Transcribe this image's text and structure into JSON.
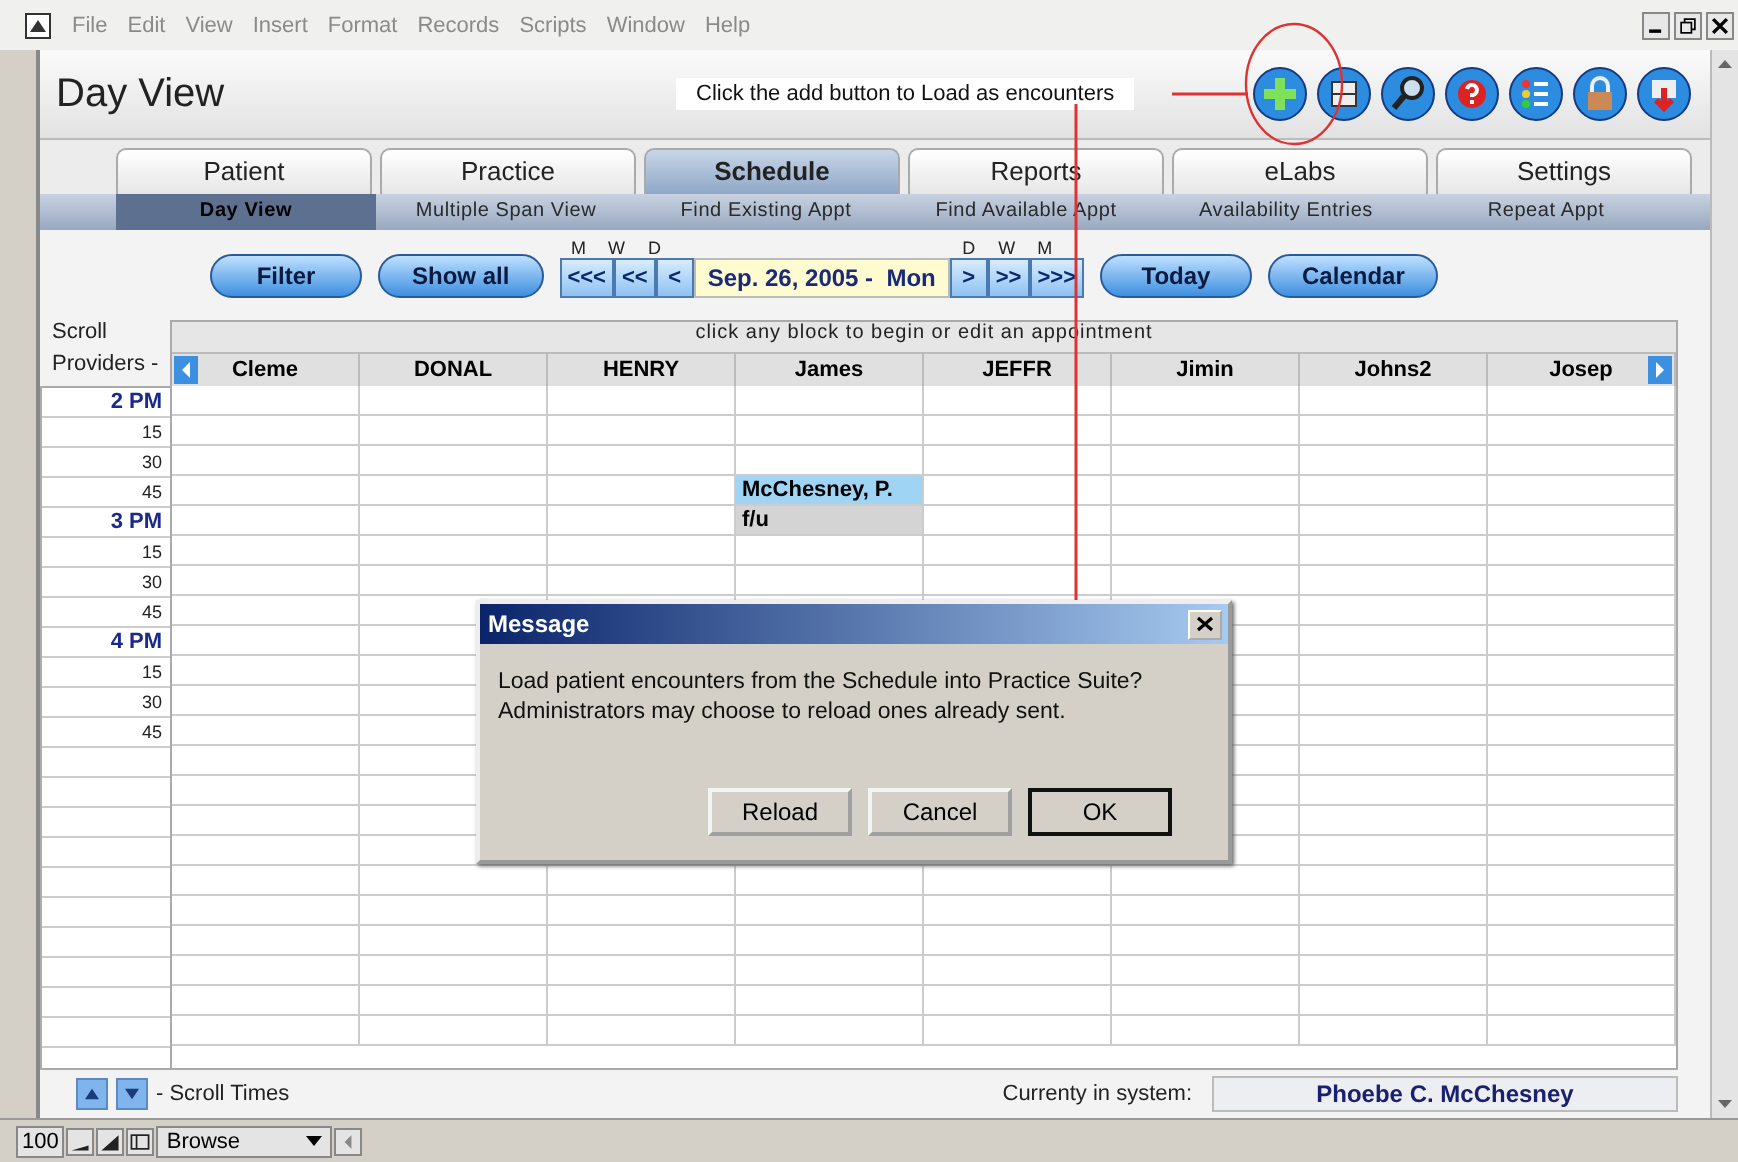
{
  "menu": [
    "File",
    "Edit",
    "View",
    "Insert",
    "Format",
    "Records",
    "Scripts",
    "Window",
    "Help"
  ],
  "header": {
    "title": "Day View",
    "hint": "Click the add button to Load as encounters"
  },
  "tabs": [
    {
      "label": "Patient",
      "selected": false
    },
    {
      "label": "Practice",
      "selected": false
    },
    {
      "label": "Schedule",
      "selected": true
    },
    {
      "label": "Reports",
      "selected": false
    },
    {
      "label": "eLabs",
      "selected": false
    },
    {
      "label": "Settings",
      "selected": false
    }
  ],
  "subtabs": [
    {
      "label": "Day View",
      "selected": true
    },
    {
      "label": "Multiple Span View",
      "selected": false
    },
    {
      "label": "Find Existing Appt",
      "selected": false
    },
    {
      "label": "Find Available Appt",
      "selected": false
    },
    {
      "label": "Availability Entries",
      "selected": false
    },
    {
      "label": "Repeat Appt",
      "selected": false
    }
  ],
  "nav": {
    "left_buttons": [
      "Filter",
      "Show all"
    ],
    "back_letters": [
      "M",
      "W",
      "D"
    ],
    "back_steps": [
      "<<<",
      "<<",
      "<"
    ],
    "date": "Sep. 26, 2005 -  Mon",
    "forward_letters": [
      "D",
      "W",
      "M"
    ],
    "forward_steps": [
      ">",
      ">>",
      ">>>"
    ],
    "right_buttons": [
      "Today",
      "Calendar"
    ]
  },
  "grid": {
    "caption": "click any block to begin or edit an appointment",
    "scroll_label": "Scroll",
    "providers_label": "Providers -",
    "providers": [
      "Cleme",
      "DONAL",
      "HENRY",
      "James",
      "JEFFR",
      "Jimin",
      "Johns2",
      "Josep"
    ],
    "rows": [
      {
        "time": "2 PM",
        "kind": "hour"
      },
      {
        "time": "15",
        "kind": "quarter"
      },
      {
        "time": "30",
        "kind": "quarter"
      },
      {
        "time": "45",
        "kind": "quarter",
        "cells": [
          {
            "kind": "empty"
          },
          {
            "kind": "empty"
          },
          {
            "kind": "empty"
          },
          {
            "kind": "name",
            "text": "McChesney, P."
          },
          {
            "kind": "empty"
          },
          {
            "kind": "empty"
          },
          {
            "kind": "empty"
          },
          {
            "kind": "empty"
          }
        ]
      },
      {
        "time": "3 PM",
        "kind": "hour",
        "cells": [
          {
            "kind": "empty"
          },
          {
            "kind": "empty"
          },
          {
            "kind": "empty"
          },
          {
            "kind": "note",
            "text": "f/u"
          },
          {
            "kind": "empty"
          },
          {
            "kind": "empty"
          },
          {
            "kind": "empty"
          },
          {
            "kind": "empty"
          }
        ]
      },
      {
        "time": "15",
        "kind": "quarter"
      },
      {
        "time": "30",
        "kind": "quarter"
      },
      {
        "time": "45",
        "kind": "quarter"
      },
      {
        "time": "4 PM",
        "kind": "hour"
      },
      {
        "time": "15",
        "kind": "quarter"
      },
      {
        "time": "30",
        "kind": "quarter"
      },
      {
        "time": "45",
        "kind": "quarter"
      }
    ]
  },
  "bottom": {
    "scroll_times": "- Scroll Times",
    "current_label": "Currenty in system:",
    "current_user": "Phoebe C. McChesney"
  },
  "status_bar": {
    "zoom": "100",
    "mode": "Browse"
  },
  "dialog": {
    "title": "Message",
    "message": "Load patient encounters from the Schedule into Practice Suite?\nAdministrators may choose to reload ones already sent.",
    "buttons": [
      {
        "label": "Reload",
        "default": false
      },
      {
        "label": "Cancel",
        "default": false
      },
      {
        "label": "OK",
        "default": true
      }
    ]
  }
}
